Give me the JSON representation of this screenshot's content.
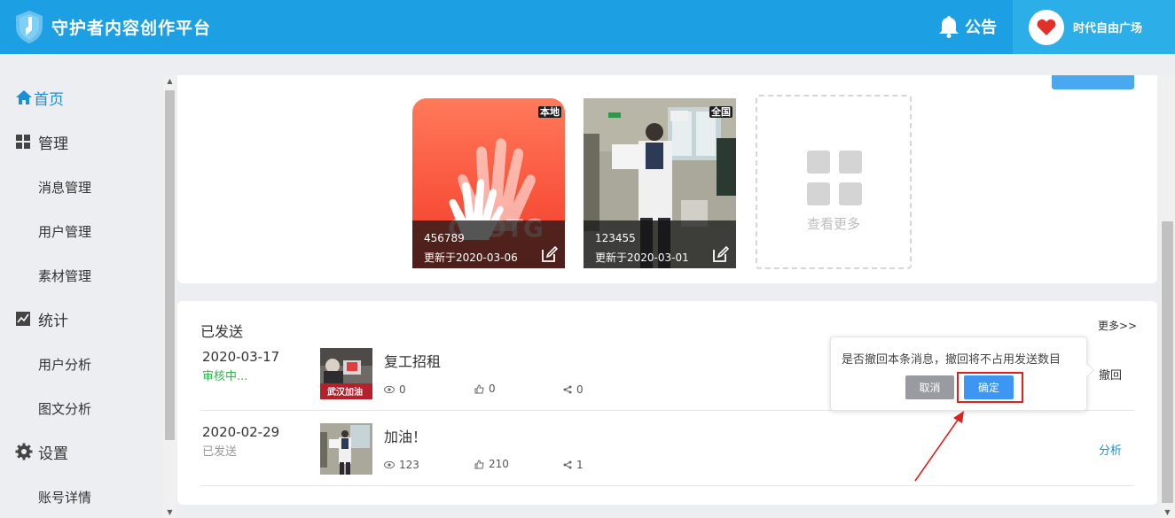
{
  "header": {
    "app_title": "守护者内容创作平台",
    "notice_label": "公告",
    "user_name": "时代自由广场"
  },
  "sidebar": {
    "home": "首页",
    "manage": "管理",
    "manage_items": [
      "消息管理",
      "用户管理",
      "素材管理"
    ],
    "stats": "统计",
    "stats_items": [
      "用户分析",
      "图文分析"
    ],
    "settings": "设置",
    "settings_items": [
      "账号详情"
    ]
  },
  "top_section": {
    "materials": [
      {
        "tag": "本地",
        "id": "456789",
        "updated": "更新于2020-03-06",
        "logo_text": "CROTG"
      },
      {
        "tag": "全国",
        "id": "123455",
        "updated": "更新于2020-03-01"
      }
    ],
    "more_label": "查看更多"
  },
  "sent": {
    "title": "已发送",
    "more": "更多>>",
    "rows": [
      {
        "date": "2020-03-17",
        "status": "审核中...",
        "status_color": "#2db84d",
        "title": "复工招租",
        "thumb_caption": "武汉加油",
        "views": "0",
        "likes": "0",
        "shares": "0",
        "action": "撤回",
        "action_color": "#333333"
      },
      {
        "date": "2020-02-29",
        "status": "已发送",
        "status_color": "#999999",
        "title": "加油！",
        "views": "123",
        "likes": "210",
        "shares": "1",
        "action": "分析",
        "action_color": "#1a8fd9"
      }
    ]
  },
  "popover": {
    "message": "是否撤回本条消息，撤回将不占用发送数目",
    "cancel": "取消",
    "confirm": "确定"
  },
  "colors": {
    "header": "#1ca0e3",
    "accent": "#1a8fd9",
    "highlight": "#e0201b"
  }
}
